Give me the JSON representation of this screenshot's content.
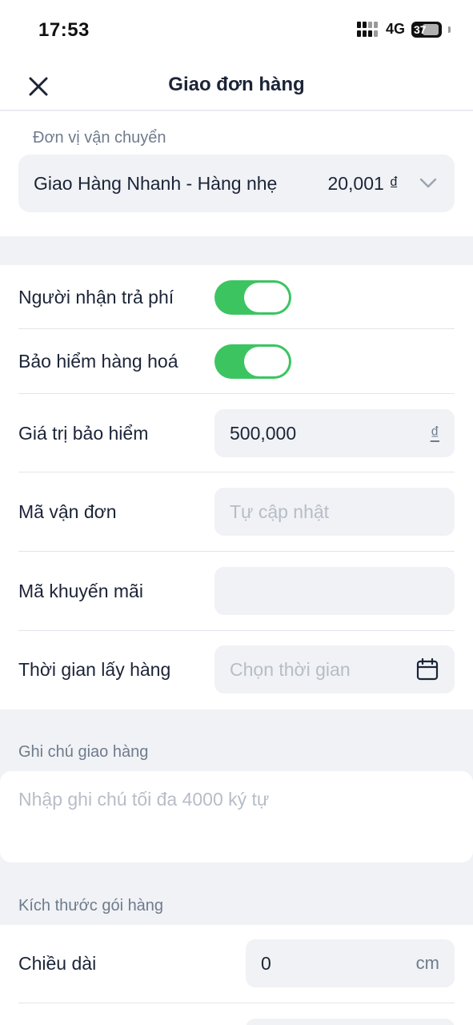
{
  "status_bar": {
    "time": "17:53",
    "network": "4G",
    "battery": "37"
  },
  "nav": {
    "title": "Giao đơn hàng",
    "close_icon": "close-icon"
  },
  "carrier": {
    "label": "Đơn vị vận chuyển",
    "name": "Giao Hàng Nhanh - Hàng nhẹ",
    "price": "20,001 ₫"
  },
  "options": {
    "receiver_pays": {
      "label": "Người nhận trả phí",
      "on": true
    },
    "insurance": {
      "label": "Bảo hiểm hàng hoá",
      "on": true
    },
    "insurance_value": {
      "label": "Giá trị bảo hiểm",
      "value": "500,000",
      "unit": "₫"
    },
    "tracking_code": {
      "label": "Mã vận đơn",
      "placeholder": "Tự cập nhật"
    },
    "promo_code": {
      "label": "Mã khuyến mãi",
      "value": ""
    },
    "pickup_time": {
      "label": "Thời gian lấy hàng",
      "placeholder": "Chọn thời gian"
    }
  },
  "notes": {
    "label": "Ghi chú giao hàng",
    "placeholder": "Nhập ghi chú tối đa 4000 ký tự"
  },
  "dimensions": {
    "label": "Kích thước gói hàng",
    "length": {
      "label": "Chiều dài",
      "value": "0",
      "unit": "cm"
    }
  },
  "colors": {
    "accent_green": "#3cc461",
    "field_bg": "#f0f2f5",
    "text": "#1b2437",
    "muted": "#6f7b8d"
  }
}
